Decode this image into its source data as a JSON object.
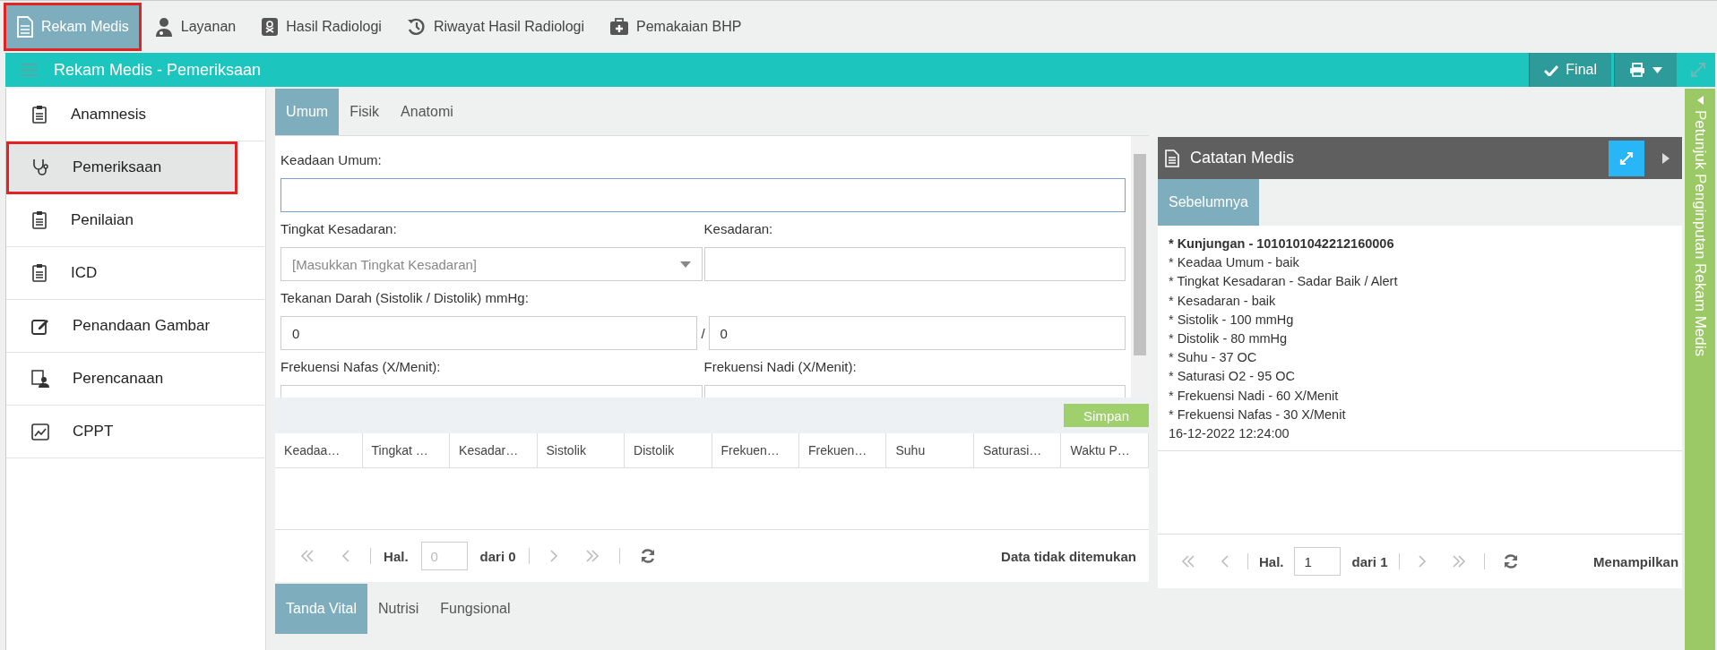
{
  "top_tabs": [
    {
      "label": "Rekam Medis",
      "selected": true,
      "highlighted": true
    },
    {
      "label": "Layanan",
      "selected": false,
      "highlighted": false
    },
    {
      "label": "Hasil Radiologi",
      "selected": false,
      "highlighted": false
    },
    {
      "label": "Riwayat Hasil Radiologi",
      "selected": false,
      "highlighted": false
    },
    {
      "label": "Pemakaian BHP",
      "selected": false,
      "highlighted": false
    }
  ],
  "header": {
    "title": "Rekam Medis - Pemeriksaan",
    "final_button": "Final"
  },
  "sidebar": {
    "items": [
      {
        "label": "Anamnesis",
        "selected": false,
        "highlighted": false
      },
      {
        "label": "Pemeriksaan",
        "selected": true,
        "highlighted": true
      },
      {
        "label": "Penilaian",
        "selected": false,
        "highlighted": false
      },
      {
        "label": "ICD",
        "selected": false,
        "highlighted": false
      },
      {
        "label": "Penandaan Gambar",
        "selected": false,
        "highlighted": false
      },
      {
        "label": "Perencanaan",
        "selected": false,
        "highlighted": false
      },
      {
        "label": "CPPT",
        "selected": false,
        "highlighted": false
      }
    ]
  },
  "sub_tabs": [
    {
      "label": "Umum",
      "selected": true
    },
    {
      "label": "Fisik",
      "selected": false
    },
    {
      "label": "Anatomi",
      "selected": false
    }
  ],
  "form": {
    "keadaan_umum": {
      "label": "Keadaan Umum:"
    },
    "tingkat_kesadaran": {
      "label": "Tingkat Kesadaran:",
      "placeholder": "[Masukkan Tingkat Kesadaran]"
    },
    "kesadaran": {
      "label": "Kesadaran:"
    },
    "tekanan_darah": {
      "label": "Tekanan Darah (Sistolik / Distolik) mmHg:",
      "sistolik": "0",
      "separator": "/",
      "distolik": "0"
    },
    "frekuensi_nafas": {
      "label": "Frekuensi Nafas (X/Menit):"
    },
    "frekuensi_nadi": {
      "label": "Frekuensi Nadi (X/Menit):"
    }
  },
  "save_button": "Simpan",
  "table": {
    "columns": [
      "Keadaa…",
      "Tingkat …",
      "Kesadar…",
      "Sistolik",
      "Distolik",
      "Frekuen…",
      "Frekuen…",
      "Suhu",
      "Saturasi…",
      "Waktu P…"
    ]
  },
  "pager": {
    "page_label": "Hal.",
    "page": "0",
    "of": "dari 0",
    "status": "Data tidak ditemukan"
  },
  "bottom_tabs": [
    {
      "label": "Tanda Vital",
      "selected": true
    },
    {
      "label": "Nutrisi",
      "selected": false
    },
    {
      "label": "Fungsional",
      "selected": false
    }
  ],
  "notes": {
    "title": "Catatan Medis",
    "tab": "Sebelumnya",
    "lines": [
      {
        "text": "* Kunjungan - 1010101042212160006",
        "bold": true
      },
      {
        "text": "* Keadaa Umum - baik",
        "bold": false
      },
      {
        "text": "* Tingkat Kesadaran - Sadar Baik / Alert",
        "bold": false
      },
      {
        "text": "* Kesadaran - baik",
        "bold": false
      },
      {
        "text": "* Sistolik - 100 mmHg",
        "bold": false
      },
      {
        "text": "* Distolik - 80 mmHg",
        "bold": false
      },
      {
        "text": "* Suhu - 37 OC",
        "bold": false
      },
      {
        "text": "* Saturasi O2 - 95 OC",
        "bold": false
      },
      {
        "text": "* Frekuensi Nadi - 60 X/Menit",
        "bold": false
      },
      {
        "text": "* Frekuensi Nafas - 30 X/Menit",
        "bold": false
      },
      {
        "text": "16-12-2022 12:24:00",
        "bold": false
      }
    ],
    "pager": {
      "page_label": "Hal.",
      "page": "1",
      "of": "dari 1",
      "status": "Menampilkan"
    }
  },
  "side_panel": {
    "label": "Petunjuk Penginputan Rekam Medis"
  }
}
